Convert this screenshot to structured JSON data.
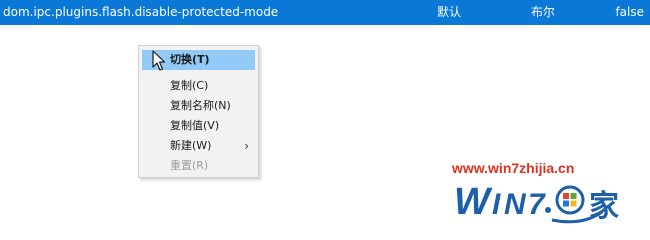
{
  "pref_row": {
    "name": "dom.ipc.plugins.flash.disable-protected-mode",
    "status": "默认",
    "type": "布尔",
    "value": "false"
  },
  "context_menu": {
    "items": [
      {
        "label": "切换(T)",
        "state": "highlighted"
      },
      {
        "label": "复制(C)",
        "state": "normal"
      },
      {
        "label": "复制名称(N)",
        "state": "normal"
      },
      {
        "label": "复制值(V)",
        "state": "normal"
      },
      {
        "label": "新建(W)",
        "state": "normal",
        "submenu": true
      },
      {
        "label": "重置(R)",
        "state": "disabled"
      }
    ],
    "submenu_icon": "chevron-right-icon",
    "cursor_icon": "arrow-cursor-icon"
  },
  "watermark": {
    "url": "www.win7zhijia.cn",
    "logo_text": "WIN7.家",
    "colors": {
      "url": "#e0301e",
      "logo_blue": "#1d5fa8"
    }
  },
  "colors": {
    "selected_row_bg": "#0a78d7",
    "menu_bg": "#f2f2f2",
    "menu_highlight": "#91c9f7",
    "disabled_text": "#9c9c9c"
  }
}
